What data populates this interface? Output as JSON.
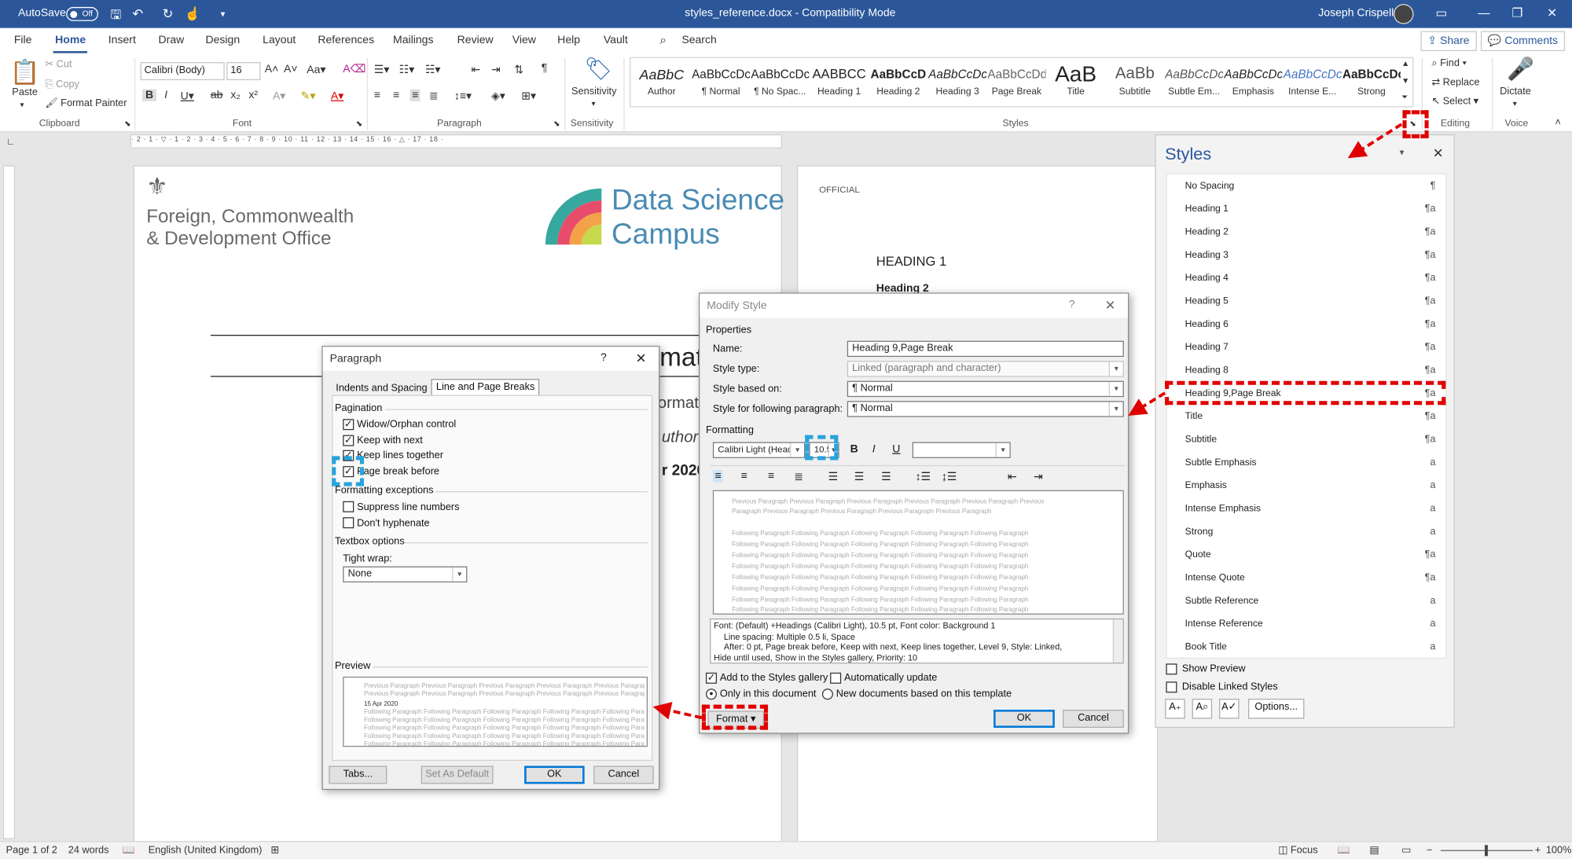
{
  "titlebar": {
    "autosave_label": "AutoSave",
    "autosave_state": "Off",
    "doc_title": "styles_reference.docx  -  Compatibility Mode",
    "user_name": "Joseph Crispell"
  },
  "tabs": [
    "File",
    "Home",
    "Insert",
    "Draw",
    "Design",
    "Layout",
    "References",
    "Mailings",
    "Review",
    "View",
    "Help",
    "Vault"
  ],
  "search_label": "Search",
  "share_label": "Share",
  "comments_label": "Comments",
  "ribbon": {
    "clipboard": {
      "paste": "Paste",
      "cut": "Cut",
      "copy": "Copy",
      "format_painter": "Format Painter",
      "group": "Clipboard"
    },
    "font": {
      "font_name": "Calibri (Body)",
      "font_size": "16",
      "group": "Font"
    },
    "paragraph_group": "Paragraph",
    "sensitivity": {
      "label": "Sensitivity",
      "group": "Sensitivity"
    },
    "styles_group": "Styles",
    "gallery": [
      {
        "preview": "AaBbC",
        "name": "Author"
      },
      {
        "preview": "AaBbCcDc",
        "name": "¶ Normal"
      },
      {
        "preview": "AaBbCcDc",
        "name": "¶ No Spac..."
      },
      {
        "preview": "AABBCC",
        "name": "Heading 1"
      },
      {
        "preview": "AaBbCcD",
        "name": "Heading 2"
      },
      {
        "preview": "AaBbCcDc",
        "name": "Heading 3"
      },
      {
        "preview": "AaBbCcDd",
        "name": "Page Break"
      },
      {
        "preview": "AaB",
        "name": "Title"
      },
      {
        "preview": "AaBb",
        "name": "Subtitle"
      },
      {
        "preview": "AaBbCcDc",
        "name": "Subtle Em..."
      },
      {
        "preview": "AaBbCcDc",
        "name": "Emphasis"
      },
      {
        "preview": "AaBbCcDc",
        "name": "Intense E..."
      },
      {
        "preview": "AaBbCcDc",
        "name": "Strong"
      }
    ],
    "editing": {
      "find": "Find",
      "replace": "Replace",
      "select": "Select",
      "group": "Editing"
    },
    "voice": {
      "dictate": "Dictate",
      "group": "Voice"
    }
  },
  "ruler_text": "· 2 · 1 · ▽ · 1 · 2 · 3 · 4 · 5 · 6 · 7 · 8 · 9 · 10 · 11 · 12 · 13 · 14 · 15 · 16 · △ · 17 · 18 ·",
  "page1": {
    "org_line1": "Foreign, Commonwealth",
    "org_line2": "& Development Office",
    "logo_line1": "Data Science",
    "logo_line2": "Campus",
    "partial_title": "mat",
    "partial_line2": "ormat",
    "partial_line3": "uthor",
    "partial_line4": "r 2020"
  },
  "page2": {
    "official": "OFFICIAL",
    "heading1": "HEADING 1",
    "heading2": "Heading 2"
  },
  "paragraph_dialog": {
    "title": "Paragraph",
    "help": "?",
    "tab1": "Indents and Spacing",
    "tab2": "Line and Page Breaks",
    "pagination": "Pagination",
    "widow": "Widow/Orphan control",
    "keep_next": "Keep with next",
    "keep_lines": "Keep lines together",
    "page_break": "Page break before",
    "exceptions": "Formatting exceptions",
    "suppress": "Suppress line numbers",
    "hyphenate": "Don't hyphenate",
    "textbox": "Textbox options",
    "tight_wrap": "Tight wrap:",
    "tight_value": "None",
    "preview": "Preview",
    "prev_line": "Previous Paragraph Previous Paragraph Previous Paragraph Previous Paragraph Previous Paragraph",
    "date_line": "15 Apr 2020",
    "follow_line": "Following Paragraph Following Paragraph Following Paragraph Following Paragraph Following Paragraph",
    "tabs_btn": "Tabs...",
    "default_btn": "Set As Default",
    "ok": "OK",
    "cancel": "Cancel"
  },
  "modify_dialog": {
    "title": "Modify Style",
    "help": "?",
    "properties": "Properties",
    "name_label": "Name:",
    "name_value": "Heading 9,Page Break",
    "type_label": "Style type:",
    "type_value": "Linked (paragraph and character)",
    "based_label": "Style based on:",
    "based_value": "¶  Normal",
    "following_label": "Style for following paragraph:",
    "following_value": "¶  Normal",
    "formatting": "Formatting",
    "font_value": "Calibri Light (Head",
    "size_value": "10.5",
    "prev_line": "Previous Paragraph Previous Paragraph Previous Paragraph Previous Paragraph Previous Paragraph Previous",
    "prev_line2": "Paragraph Previous Paragraph Previous Paragraph Previous Paragraph Previous Paragraph",
    "follow_line": "Following Paragraph Following Paragraph Following Paragraph Following Paragraph Following Paragraph",
    "desc1": "Font: (Default) +Headings (Calibri Light), 10.5 pt, Font color: Background 1",
    "desc2": "Line spacing:  Multiple 0.5 li, Space",
    "desc3": "After:  0 pt, Page break before, Keep with next, Keep lines together, Level 9, Style: Linked,",
    "desc4": "Hide until used, Show in the Styles gallery, Priority: 10",
    "add_gallery": "Add to the Styles gallery",
    "auto_update": "Automatically update",
    "only_doc": "Only in this document",
    "new_docs": "New documents based on this template",
    "format_btn": "Format ▾",
    "ok": "OK",
    "cancel": "Cancel"
  },
  "styles_pane": {
    "title": "Styles",
    "items": [
      {
        "name": "No Spacing",
        "icon": "¶"
      },
      {
        "name": "Heading 1",
        "icon": "¶a"
      },
      {
        "name": "Heading 2",
        "icon": "¶a"
      },
      {
        "name": "Heading 3",
        "icon": "¶a"
      },
      {
        "name": "Heading 4",
        "icon": "¶a"
      },
      {
        "name": "Heading 5",
        "icon": "¶a"
      },
      {
        "name": "Heading 6",
        "icon": "¶a"
      },
      {
        "name": "Heading 7",
        "icon": "¶a"
      },
      {
        "name": "Heading 8",
        "icon": "¶a"
      },
      {
        "name": "Heading 9,Page Break",
        "icon": "¶a"
      },
      {
        "name": "Title",
        "icon": "¶a"
      },
      {
        "name": "Subtitle",
        "icon": "¶a"
      },
      {
        "name": "Subtle Emphasis",
        "icon": "a"
      },
      {
        "name": "Emphasis",
        "icon": "a"
      },
      {
        "name": "Intense Emphasis",
        "icon": "a"
      },
      {
        "name": "Strong",
        "icon": "a"
      },
      {
        "name": "Quote",
        "icon": "¶a"
      },
      {
        "name": "Intense Quote",
        "icon": "¶a"
      },
      {
        "name": "Subtle Reference",
        "icon": "a"
      },
      {
        "name": "Intense Reference",
        "icon": "a"
      },
      {
        "name": "Book Title",
        "icon": "a"
      }
    ],
    "show_preview": "Show Preview",
    "disable_linked": "Disable Linked Styles",
    "options_btn": "Options..."
  },
  "status": {
    "page": "Page 1 of 2",
    "words": "24 words",
    "language": "English (United Kingdom)",
    "focus": "Focus",
    "zoom": "100%"
  },
  "colors": {
    "accent": "#2b579a",
    "annotation_red": "#e00000",
    "annotation_blue": "#29a3dc"
  }
}
